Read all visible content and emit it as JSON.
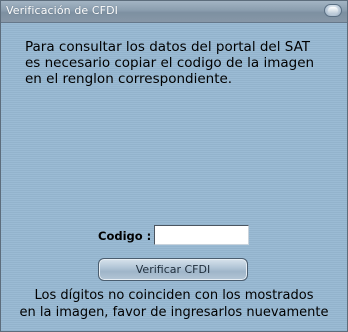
{
  "window": {
    "title": "Verificación de CFDI",
    "close_icon": "close-icon"
  },
  "instructions": "Para consultar los datos del portal del SAT\nes necesario copiar el codigo de la imagen\nen el renglon correspondiente.",
  "form": {
    "codigo_label": "Codigo :",
    "codigo_value": "",
    "verify_button_label": "Verificar CFDI"
  },
  "error_message": "Los dígitos no coinciden con los mostrados\nen la imagen, favor de ingresarlos nuevamente",
  "colors": {
    "window_background": "#96b6cf",
    "title_bar": "#8a9dae",
    "text": "#000000"
  }
}
